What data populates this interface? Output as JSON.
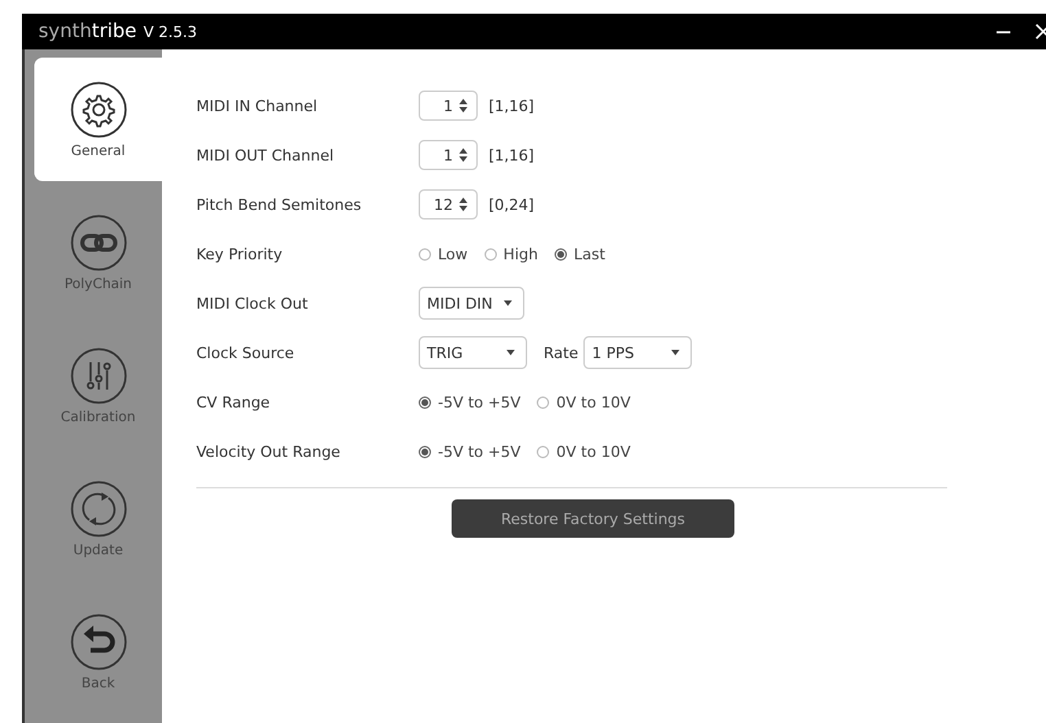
{
  "window": {
    "title_light": "synth",
    "title_bold": "tribe",
    "version": "V 2.5.3"
  },
  "sidebar": {
    "items": [
      {
        "label": "General",
        "kind": "gear",
        "selected": true
      },
      {
        "label": "PolyChain",
        "kind": "link",
        "selected": false
      },
      {
        "label": "Calibration",
        "kind": "sliders",
        "selected": false
      },
      {
        "label": "Update",
        "kind": "refresh",
        "selected": false
      },
      {
        "label": "Back",
        "kind": "back",
        "selected": false
      }
    ]
  },
  "settings": [
    {
      "kind": "spinner",
      "label": "MIDI IN Channel",
      "value": "1",
      "range": "[1,16]"
    },
    {
      "kind": "spinner",
      "label": "MIDI OUT Channel",
      "value": "1",
      "range": "[1,16]"
    },
    {
      "kind": "spinner",
      "label": "Pitch Bend Semitones",
      "value": "12",
      "range": "[0,24]"
    },
    {
      "kind": "radio",
      "label": "Key Priority",
      "options": [
        {
          "label": "Low",
          "selected": false
        },
        {
          "label": "High",
          "selected": false
        },
        {
          "label": "Last",
          "selected": true
        }
      ]
    },
    {
      "kind": "select",
      "label": "MIDI Clock Out",
      "value": "MIDI DIN"
    },
    {
      "kind": "select2",
      "label": "Clock Source",
      "value": "TRIG",
      "second_label": "Rate",
      "second_value": "1 PPS"
    },
    {
      "kind": "radio",
      "label": "CV Range",
      "options": [
        {
          "label": "-5V to +5V",
          "selected": true
        },
        {
          "label": "0V to 10V",
          "selected": false
        }
      ]
    },
    {
      "kind": "radio",
      "label": "Velocity Out Range",
      "options": [
        {
          "label": "-5V to +5V",
          "selected": true
        },
        {
          "label": "0V to 10V",
          "selected": false
        }
      ]
    }
  ],
  "restore_button": "Restore Factory Settings"
}
